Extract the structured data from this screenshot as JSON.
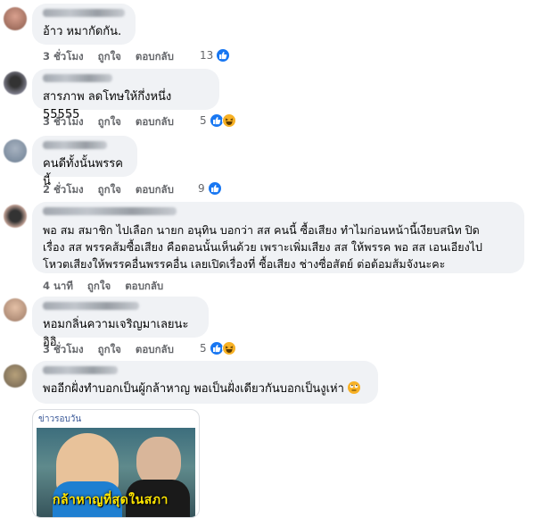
{
  "comments": [
    {
      "text": "อ้าว หมากัดกัน.",
      "time": "3 ชั่วโมง",
      "like": "ถูกใจ",
      "reply": "ตอบกลับ",
      "reactions": "13",
      "reaction_icons": [
        "like-icon"
      ]
    },
    {
      "text": "สารภาพ ลดโทษให้กึ่งหนึ่ง 55555",
      "time": "3 ชั่วโมง",
      "like": "ถูกใจ",
      "reply": "ตอบกลับ",
      "reactions": "5",
      "reaction_icons": [
        "like-icon",
        "haha-icon"
      ]
    },
    {
      "text": "คนดีทั้งนั้นพรรคนี้",
      "time": "2 ชั่วโมง",
      "like": "ถูกใจ",
      "reply": "ตอบกลับ",
      "reactions": "9",
      "reaction_icons": [
        "like-icon"
      ]
    },
    {
      "text": "พอ สม สมาชิก ไปเลือก นายก อนุทิน บอกว่า สส คนนี้ ซื้อเสียง ทำไมก่อนหน้านี้เงียบสนิท ปิด\nเรื่อง สส พรรคส้มซื้อเสียง คือตอนนั้นเห็นด้วย เพราะเพิ่มเสียง สส ให้พรรค พอ สส เอนเอียงไป\nโหวตเสียงให้พรรคอื่นพรรคอื่น เลยเปิดเรื่องที่ ซื้อเสียง ช่างซื่อสัตย์ ต่อต้อมส้มจังนะคะ",
      "time": "4 นาที",
      "like": "ถูกใจ",
      "reply": "ตอบกลับ",
      "reactions": "",
      "reaction_icons": []
    },
    {
      "text": "หอมกลิ่นความเจริญมาเลยนะ อิอิ",
      "time": "3 ชั่วโมง",
      "like": "ถูกใจ",
      "reply": "ตอบกลับ",
      "reactions": "5",
      "reaction_icons": [
        "like-icon",
        "haha-icon"
      ]
    },
    {
      "text": "พออีกฝั่งทำบอกเป็นผู้กล้าหาญ พอเป็นฝั่งเดียวกันบอกเป็นงูเห่า",
      "time": "",
      "like": "",
      "reply": "",
      "reactions": "",
      "reaction_icons": [
        "rolling-eyes-emoji"
      ]
    }
  ],
  "link_card": {
    "label": "ข่าวรอบวัน",
    "caption": "กล้าหาญที่สุดในสภา"
  },
  "colors": {
    "like": "#1877f2",
    "haha": "#f7b125",
    "bubble": "#f0f2f5",
    "meta": "#65676b"
  }
}
